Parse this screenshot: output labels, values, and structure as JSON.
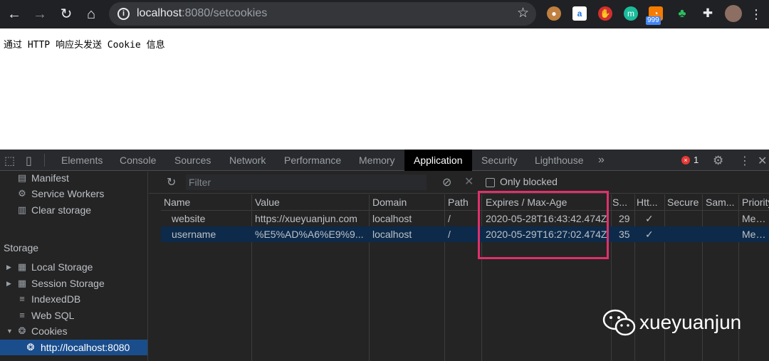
{
  "browser": {
    "url_host": "localhost",
    "url_rest": ":8080/setcookies",
    "ext_badge": "999"
  },
  "page": {
    "text": "通过 HTTP 响应头发送 Cookie 信息"
  },
  "devtools": {
    "tabs": [
      "Elements",
      "Console",
      "Sources",
      "Network",
      "Performance",
      "Memory",
      "Application",
      "Security",
      "Lighthouse"
    ],
    "active_tab": "Application",
    "more_tabs": "»",
    "error_count": "1",
    "error_mark": "×"
  },
  "sidebar": {
    "app_items": [
      "Manifest",
      "Service Workers",
      "Clear storage"
    ],
    "storage_header": "Storage",
    "storage_items": [
      "Local Storage",
      "Session Storage",
      "IndexedDB",
      "Web SQL",
      "Cookies"
    ],
    "cookie_origin": "http://localhost:8080"
  },
  "cookies": {
    "filter_placeholder": "Filter",
    "only_blocked": "Only blocked",
    "columns": [
      "Name",
      "Value",
      "Domain",
      "Path",
      "Expires / Max-Age",
      "S...",
      "Htt...",
      "Secure",
      "Sam...",
      "Priority"
    ],
    "rows": [
      [
        "website",
        "https://xueyuanjun.com",
        "localhost",
        "/",
        "2020-05-28T16:43:42.474Z",
        "29",
        "✓",
        "",
        "",
        "Med..."
      ],
      [
        "username",
        "%E5%AD%A6%E9%9...",
        "localhost",
        "/",
        "2020-05-29T16:27:02.474Z",
        "35",
        "✓",
        "",
        "",
        "Med..."
      ]
    ],
    "selected_row": 1
  },
  "watermark": {
    "text": "xueyuanjun"
  },
  "colors": {
    "highlight": "#e0306b",
    "selected_row": "#0d2a4a",
    "sidebar_selected": "#1a4d8c"
  }
}
